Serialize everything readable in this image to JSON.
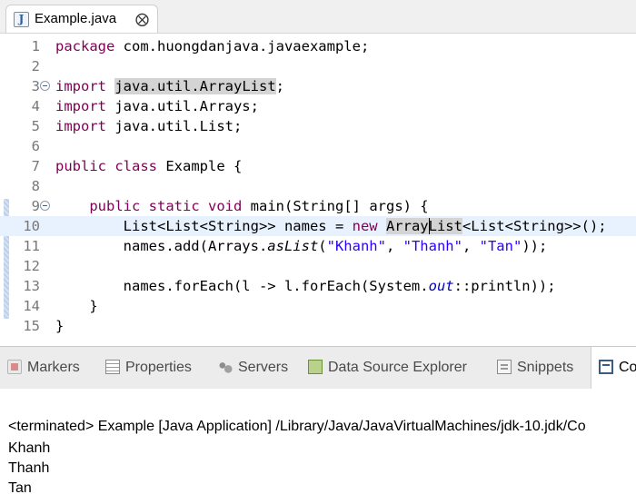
{
  "editor": {
    "tab": {
      "icon": "java-file-icon",
      "icon_glyph": "J",
      "title": "Example.java",
      "close_glyph": "⨂"
    },
    "lines": [
      {
        "num": "1",
        "segments": [
          {
            "t": "package",
            "c": "kw"
          },
          {
            "t": " com.huongdanjava.javaexample;",
            "c": ""
          }
        ]
      },
      {
        "num": "2",
        "segments": []
      },
      {
        "num": "3",
        "fold": true,
        "segments": [
          {
            "t": "import",
            "c": "kw"
          },
          {
            "t": " ",
            "c": ""
          },
          {
            "t": "java.util.ArrayList",
            "c": "hl"
          },
          {
            "t": ";",
            "c": ""
          }
        ]
      },
      {
        "num": "4",
        "segments": [
          {
            "t": "import",
            "c": "kw"
          },
          {
            "t": " java.util.Arrays;",
            "c": ""
          }
        ]
      },
      {
        "num": "5",
        "segments": [
          {
            "t": "import",
            "c": "kw"
          },
          {
            "t": " java.util.List;",
            "c": ""
          }
        ]
      },
      {
        "num": "6",
        "segments": []
      },
      {
        "num": "7",
        "segments": [
          {
            "t": "public",
            "c": "kw"
          },
          {
            "t": " ",
            "c": ""
          },
          {
            "t": "class",
            "c": "kw"
          },
          {
            "t": " Example {",
            "c": ""
          }
        ]
      },
      {
        "num": "8",
        "segments": []
      },
      {
        "num": "9",
        "fold": true,
        "segments": [
          {
            "t": "    ",
            "c": ""
          },
          {
            "t": "public",
            "c": "kw"
          },
          {
            "t": " ",
            "c": ""
          },
          {
            "t": "static",
            "c": "kw"
          },
          {
            "t": " ",
            "c": ""
          },
          {
            "t": "void",
            "c": "kw"
          },
          {
            "t": " main(String[] args) {",
            "c": ""
          }
        ]
      },
      {
        "num": "10",
        "current": true,
        "segments": [
          {
            "t": "        List<List<String>> names = ",
            "c": ""
          },
          {
            "t": "new",
            "c": "kw"
          },
          {
            "t": " ",
            "c": ""
          },
          {
            "t": "Array",
            "c": "hl"
          },
          {
            "t": "",
            "c": "cursor"
          },
          {
            "t": "List",
            "c": "hl"
          },
          {
            "t": "<List<String>>();",
            "c": ""
          }
        ]
      },
      {
        "num": "11",
        "segments": [
          {
            "t": "        names.add(Arrays.",
            "c": ""
          },
          {
            "t": "asList",
            "c": "sta"
          },
          {
            "t": "(",
            "c": ""
          },
          {
            "t": "\"Khanh\"",
            "c": "str"
          },
          {
            "t": ", ",
            "c": ""
          },
          {
            "t": "\"Thanh\"",
            "c": "str"
          },
          {
            "t": ", ",
            "c": ""
          },
          {
            "t": "\"Tan\"",
            "c": "str"
          },
          {
            "t": "));",
            "c": ""
          }
        ]
      },
      {
        "num": "12",
        "segments": []
      },
      {
        "num": "13",
        "segments": [
          {
            "t": "        names.forEach(l -> l.forEach(System.",
            "c": ""
          },
          {
            "t": "out",
            "c": "fld"
          },
          {
            "t": "::println));",
            "c": ""
          }
        ]
      },
      {
        "num": "14",
        "segments": [
          {
            "t": "    }",
            "c": ""
          }
        ]
      },
      {
        "num": "15",
        "segments": [
          {
            "t": "}",
            "c": ""
          }
        ]
      }
    ]
  },
  "panel": {
    "tabs": [
      {
        "id": "markers",
        "label": "Markers",
        "icon": "markers-icon"
      },
      {
        "id": "properties",
        "label": "Properties",
        "icon": "properties-icon"
      },
      {
        "id": "servers",
        "label": "Servers",
        "icon": "servers-icon"
      },
      {
        "id": "datasource",
        "label": "Data Source Explorer",
        "icon": "data-source-icon"
      },
      {
        "id": "snippets",
        "label": "Snippets",
        "icon": "snippets-icon"
      },
      {
        "id": "console",
        "label": "Co",
        "icon": "console-icon",
        "active": true
      }
    ]
  },
  "console": {
    "status": "<terminated> Example [Java Application] /Library/Java/JavaVirtualMachines/jdk-10.jdk/Co",
    "output": [
      "Khanh",
      "Thanh",
      "Tan"
    ]
  }
}
